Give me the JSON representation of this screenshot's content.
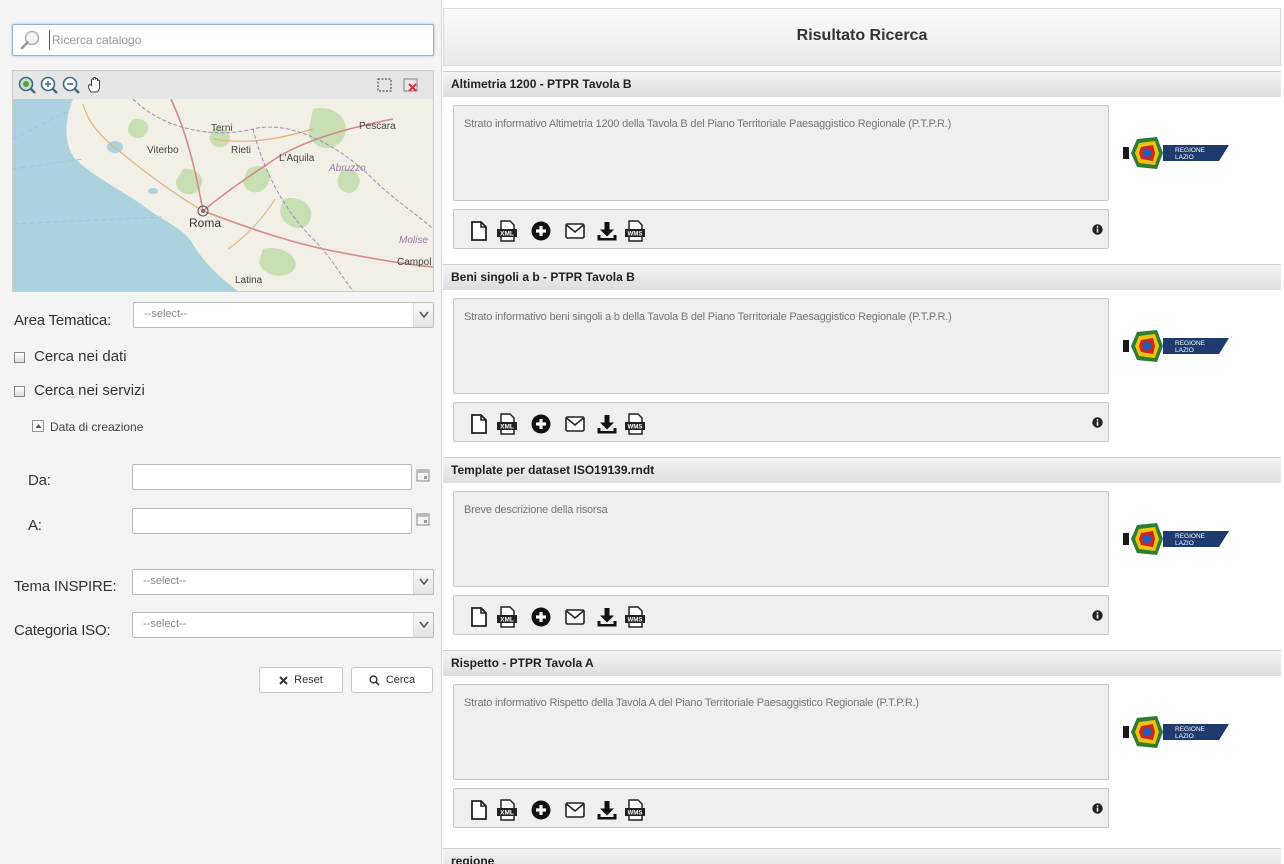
{
  "search": {
    "placeholder": "Ricerca catalogo"
  },
  "map": {
    "labels": [
      "Terni",
      "Pescara",
      "Viterbo",
      "Rieti",
      "L'Aquila",
      "Abruzzo",
      "Roma",
      "Molise",
      "Campol",
      "Latina"
    ],
    "tools": [
      "zoom-extent-icon",
      "zoom-in-icon",
      "zoom-out-icon",
      "pan-hand-icon",
      "select-box-icon",
      "clear-selection-icon"
    ]
  },
  "form": {
    "area_label": "Area Tematica:",
    "area_value": "--select--",
    "cerca_dati": "Cerca nei dati",
    "cerca_servizi": "Cerca nei servizi",
    "data_creazione": "Data di creazione",
    "da_label": "Da:",
    "a_label": "A:",
    "tema_label": "Tema INSPIRE:",
    "tema_value": "--select--",
    "categoria_label": "Categoria ISO:",
    "categoria_value": "--select--",
    "reset_label": "Reset",
    "cerca_label": "Cerca"
  },
  "results": {
    "header": "Risultato Ricerca",
    "records": [
      {
        "title": "Altimetria 1200 - PTPR Tavola B",
        "description": "Strato informativo Altimetria 1200 della Tavola B del Piano Territoriale Paesaggistico Regionale (P.T.P.R.)"
      },
      {
        "title": "Beni singoli a b - PTPR Tavola B",
        "description": "Strato informativo beni singoli a b della Tavola B del Piano Territoriale Paesaggistico Regionale (P.T.P.R.)"
      },
      {
        "title": "Template per dataset ISO19139.rndt",
        "description": "Breve descrizione della risorsa"
      },
      {
        "title": "Rispetto - PTPR Tavola A",
        "description": "Strato informativo Rispetto della Tavola A del Piano Territoriale Paesaggistico Regionale (P.T.P.R.)"
      }
    ],
    "partial_title": "regione",
    "logo_text": [
      "REGIONE",
      "LAZIO"
    ],
    "tools": [
      "document-icon",
      "xml-icon",
      "add-circle-icon",
      "envelope-icon",
      "download-icon",
      "wms-icon"
    ],
    "xml_badge": "XML",
    "wms_badge": "WMS"
  },
  "colors": {
    "accent": "#8fb3d6",
    "logo_blue": "#1e3a6e",
    "header_bg": "#ececec"
  }
}
